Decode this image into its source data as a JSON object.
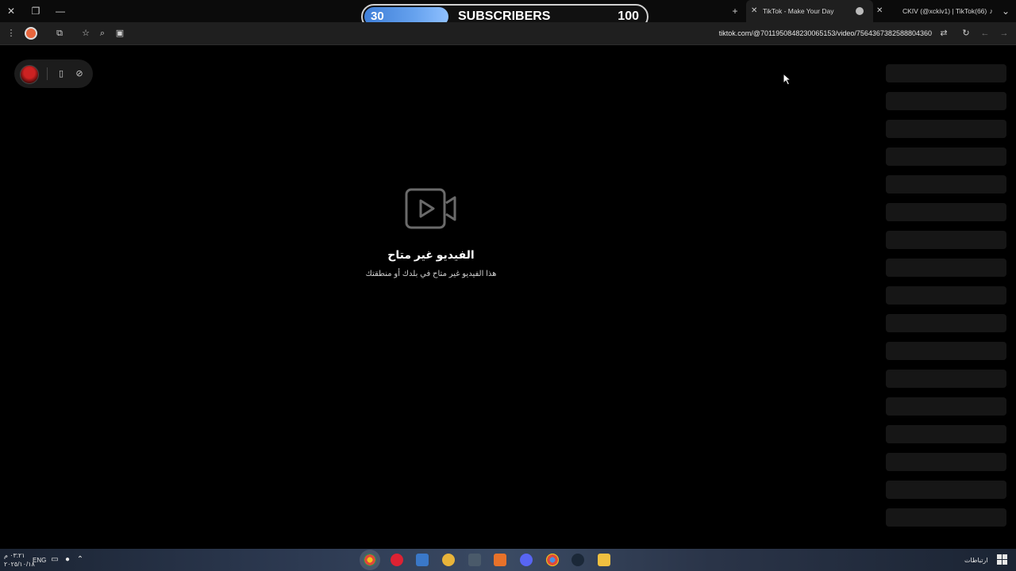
{
  "subscriber_goal": {
    "current": "30",
    "label": "SUBSCRIBERS",
    "goal": "100",
    "progress_fraction": 0.3
  },
  "tabs": [
    {
      "title": "TikTok - Make Your Day",
      "active": true
    },
    {
      "title": "CKIV (@xckiv1) | TikTok(66)",
      "active": false
    }
  ],
  "address_bar": {
    "url": "tiktok.com/@7011950848230065153/video/7564367382588804360"
  },
  "unavailable": {
    "title": "الفيديو غير متاح",
    "message": "هذا الفيديو غير متاح في بلدك أو منطقتك"
  },
  "taskbar": {
    "language": "ENG",
    "time": "٠٣:٢١ م",
    "date": "٢٠٢٥/١٠/١٨",
    "connections_label": "ارتباطات"
  },
  "icons": {
    "window_close": "close-icon",
    "window_restore": "restore-icon",
    "window_minimize": "minimize-icon",
    "new_tab": "plus-icon",
    "menu": "kebab-menu-icon",
    "extensions": "puzzle-icon",
    "bookmark": "star-icon",
    "zoom": "zoom-icon",
    "reload": "reload-icon",
    "back": "arrow-left-icon",
    "forward": "arrow-right-icon",
    "video_unavailable": "video-camera-icon"
  },
  "colors": {
    "page_background": "#000000",
    "progress_fill": "#4a8ae0",
    "skeleton": "#161616"
  }
}
